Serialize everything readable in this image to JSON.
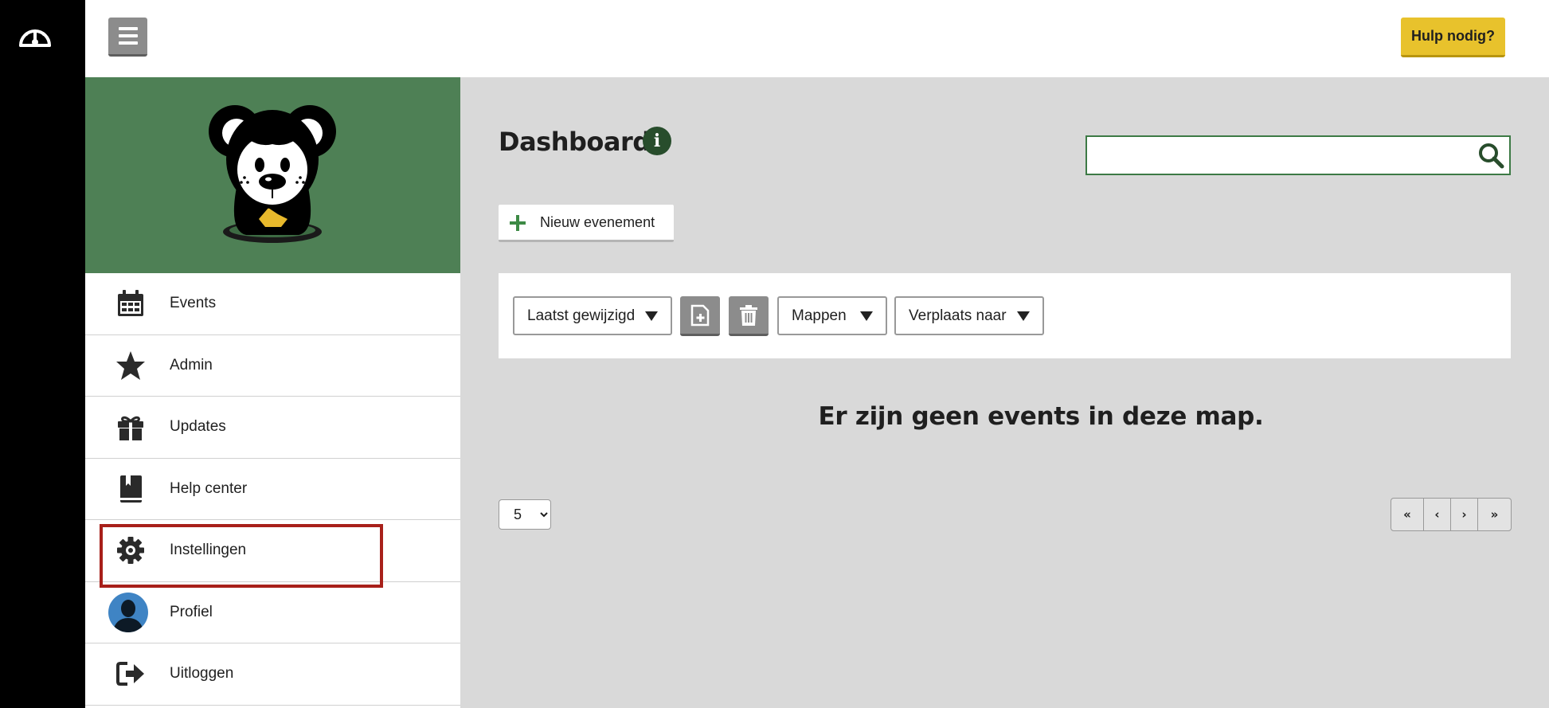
{
  "header": {
    "help_label": "Hulp nodig?"
  },
  "sidebar": {
    "items": [
      {
        "label": "Events",
        "icon": "calendar-icon"
      },
      {
        "label": "Admin",
        "icon": "star-icon"
      },
      {
        "label": "Updates",
        "icon": "gift-icon"
      },
      {
        "label": "Help center",
        "icon": "book-icon"
      },
      {
        "label": "Instellingen",
        "icon": "gear-icon"
      },
      {
        "label": "Profiel",
        "icon": "avatar-icon"
      },
      {
        "label": "Uitloggen",
        "icon": "logout-icon"
      }
    ]
  },
  "main": {
    "title": "Dashboard",
    "info_icon": "i",
    "search": {
      "value": "",
      "placeholder": ""
    },
    "new_event_label": "Nieuw evenement",
    "toolbar": {
      "sort_label": "Laatst gewijzigd",
      "folders_label": "Mappen",
      "move_label": "Verplaats naar"
    },
    "empty_message": "Er zijn geen events in deze map.",
    "page_size": {
      "selected": "5",
      "options": [
        "5"
      ]
    },
    "pager": {
      "first": "«",
      "prev": "‹",
      "next": "›",
      "last": "»"
    }
  },
  "colors": {
    "brand_green": "#4e8055",
    "dark_green": "#284d2c",
    "help_yellow": "#e8c22c",
    "highlight_red": "#a8201a"
  }
}
